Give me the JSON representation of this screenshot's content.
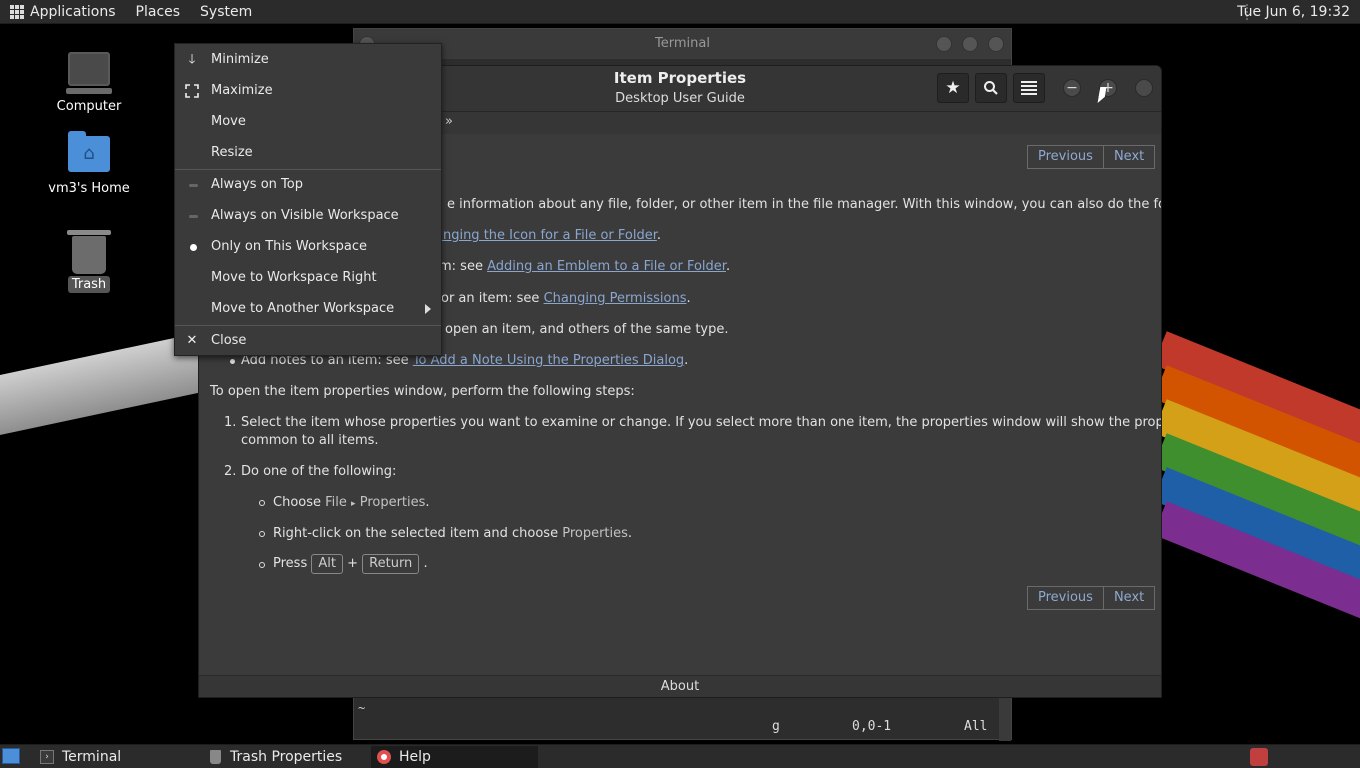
{
  "top_panel": {
    "menus": [
      "Applications",
      "Places",
      "System"
    ],
    "clock": "Tue Jun  6, 19:32"
  },
  "desktop": {
    "icons": [
      {
        "label": "Computer",
        "icon": "computer-icon"
      },
      {
        "label": "vm3's Home",
        "icon": "home-folder-icon"
      },
      {
        "label": "Trash",
        "icon": "trash-icon"
      }
    ]
  },
  "terminal": {
    "title": "Terminal",
    "tilde": "~",
    "status_g": "g",
    "status_pos": "0,0-1",
    "status_all": "All"
  },
  "help": {
    "title": "Item Properties",
    "subtitle": "Desktop User Guide",
    "breadcrumb": "»",
    "nav": {
      "previous": "Previous",
      "next": "Next"
    },
    "lines": {
      "intro": "e information about any file, folder, or other item in the file manager. With this window, you can also do the following:",
      "b1_link": "anging the Icon for a File or Folder",
      "b1_end": ".",
      "b2_pre": "m: see ",
      "b2_link": "Adding an Emblem to a File or Folder",
      "b2_end": ".",
      "b3_pre": "or an item: see ",
      "b3_link": "Changing Permissions",
      "b3_end": ".",
      "b4": "open an item, and others of the same type.",
      "b5_pre": "Add notes to an item: see ",
      "b5_link": "To Add a Note Using the Properties Dialog",
      "b5_end": ".",
      "steps_intro": "To open the item properties window, perform the following steps:",
      "step1_num": "1.",
      "step1_a": "Select the item whose properties you want to examine or change. If you select more than one item, the properties window will show the properties that are in",
      "step1_b": "common to all items.",
      "step2_num": "2.",
      "step2": "Do one of the following:",
      "sub1_pre": "Choose ",
      "sub1_file": "File",
      "sub1_arrow": "▸",
      "sub1_props": "Properties",
      "sub1_end": ".",
      "sub2_pre": "Right-click on the selected item and choose ",
      "sub2_props": "Properties",
      "sub2_end": ".",
      "sub3_pre": "Press ",
      "sub3_key1": "Alt",
      "sub3_plus": "+",
      "sub3_key2": "Return",
      "sub3_end": "."
    },
    "footer": "About"
  },
  "window_menu": {
    "items": [
      {
        "label": "Minimize",
        "icon": "arrow-down-icon"
      },
      {
        "label": "Maximize",
        "icon": "maximize-icon"
      },
      {
        "label": "Move"
      },
      {
        "label": "Resize"
      },
      {
        "label": "Always on Top",
        "radio": "off"
      },
      {
        "label": "Always on Visible Workspace",
        "radio": "off"
      },
      {
        "label": "Only on This Workspace",
        "radio": "on"
      },
      {
        "label": "Move to Workspace Right"
      },
      {
        "label": "Move to Another Workspace",
        "submenu": true
      },
      {
        "label": "Close",
        "icon": "close-icon"
      }
    ]
  },
  "taskbar": {
    "tasks": [
      {
        "label": "Terminal",
        "icon": "terminal-icon"
      },
      {
        "label": "Trash Properties",
        "icon": "trash-icon"
      },
      {
        "label": "Help",
        "icon": "help-lifebuoy-icon"
      }
    ]
  },
  "colors": {
    "link": "#8aa6cf",
    "panel": "#2b2b2b",
    "window": "#3b3b3b",
    "accent_folder": "#4a8fd8"
  }
}
